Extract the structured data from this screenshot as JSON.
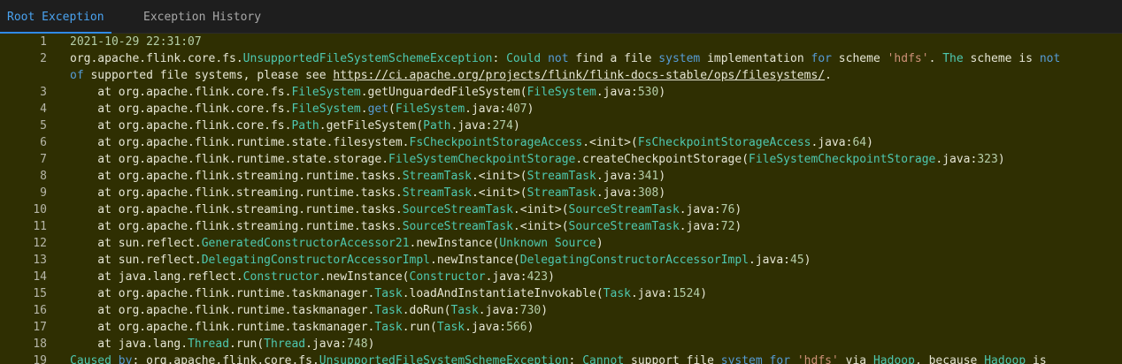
{
  "tabs": [
    {
      "label": "Root Exception",
      "active": true
    },
    {
      "label": "Exception History",
      "active": false
    }
  ],
  "colors": {
    "editor_background": "#2f2f02",
    "active_tab": "#4aa3f0",
    "class_name": "#4ec9b0",
    "number": "#b5cea8",
    "keyword": "#569cd6",
    "string": "#ce9178"
  },
  "lines": [
    {
      "n": "1",
      "segments": [
        {
          "t": "2021-10-29 22:31:07",
          "c": "num"
        }
      ]
    },
    {
      "n": "2",
      "segments": [
        {
          "t": "org.apache.flink.core.fs.",
          "c": ""
        },
        {
          "t": "UnsupportedFileSystemSchemeException",
          "c": "cls"
        },
        {
          "t": ": ",
          "c": ""
        },
        {
          "t": "Could ",
          "c": "cls"
        },
        {
          "t": "not",
          "c": "kw"
        },
        {
          "t": " find a file ",
          "c": ""
        },
        {
          "t": "system",
          "c": "kw"
        },
        {
          "t": " implementation ",
          "c": ""
        },
        {
          "t": "for",
          "c": "kw"
        },
        {
          "t": " scheme ",
          "c": ""
        },
        {
          "t": "'hdfs'",
          "c": "str"
        },
        {
          "t": ". ",
          "c": ""
        },
        {
          "t": "The",
          "c": "cls"
        },
        {
          "t": " scheme is ",
          "c": ""
        },
        {
          "t": "not",
          "c": "kw"
        }
      ]
    },
    {
      "n": "",
      "segments": [
        {
          "t": "of",
          "c": "kw"
        },
        {
          "t": " supported file systems, please see ",
          "c": ""
        },
        {
          "t": "https://ci.apache.org/projects/flink/flink-docs-stable/ops/filesystems/",
          "c": "link"
        },
        {
          "t": ".",
          "c": ""
        }
      ]
    },
    {
      "n": "3",
      "segments": [
        {
          "t": "    at org.apache.flink.core.fs.",
          "c": ""
        },
        {
          "t": "FileSystem",
          "c": "cls"
        },
        {
          "t": ".getUnguardedFileSystem(",
          "c": ""
        },
        {
          "t": "FileSystem",
          "c": "cls"
        },
        {
          "t": ".java:",
          "c": ""
        },
        {
          "t": "530",
          "c": "num"
        },
        {
          "t": ")",
          "c": ""
        }
      ]
    },
    {
      "n": "4",
      "segments": [
        {
          "t": "    at org.apache.flink.core.fs.",
          "c": ""
        },
        {
          "t": "FileSystem",
          "c": "cls"
        },
        {
          "t": ".",
          "c": ""
        },
        {
          "t": "get",
          "c": "kw"
        },
        {
          "t": "(",
          "c": ""
        },
        {
          "t": "FileSystem",
          "c": "cls"
        },
        {
          "t": ".java:",
          "c": ""
        },
        {
          "t": "407",
          "c": "num"
        },
        {
          "t": ")",
          "c": ""
        }
      ]
    },
    {
      "n": "5",
      "segments": [
        {
          "t": "    at org.apache.flink.core.fs.",
          "c": ""
        },
        {
          "t": "Path",
          "c": "cls"
        },
        {
          "t": ".getFileSystem(",
          "c": ""
        },
        {
          "t": "Path",
          "c": "cls"
        },
        {
          "t": ".java:",
          "c": ""
        },
        {
          "t": "274",
          "c": "num"
        },
        {
          "t": ")",
          "c": ""
        }
      ]
    },
    {
      "n": "6",
      "segments": [
        {
          "t": "    at org.apache.flink.runtime.state.filesystem.",
          "c": ""
        },
        {
          "t": "FsCheckpointStorageAccess",
          "c": "cls"
        },
        {
          "t": ".<init>(",
          "c": ""
        },
        {
          "t": "FsCheckpointStorageAccess",
          "c": "cls"
        },
        {
          "t": ".java:",
          "c": ""
        },
        {
          "t": "64",
          "c": "num"
        },
        {
          "t": ")",
          "c": ""
        }
      ]
    },
    {
      "n": "7",
      "segments": [
        {
          "t": "    at org.apache.flink.runtime.state.storage.",
          "c": ""
        },
        {
          "t": "FileSystemCheckpointStorage",
          "c": "cls"
        },
        {
          "t": ".createCheckpointStorage(",
          "c": ""
        },
        {
          "t": "FileSystemCheckpointStorage",
          "c": "cls"
        },
        {
          "t": ".java:",
          "c": ""
        },
        {
          "t": "323",
          "c": "num"
        },
        {
          "t": ")",
          "c": ""
        }
      ]
    },
    {
      "n": "8",
      "segments": [
        {
          "t": "    at org.apache.flink.streaming.runtime.tasks.",
          "c": ""
        },
        {
          "t": "StreamTask",
          "c": "cls"
        },
        {
          "t": ".<init>(",
          "c": ""
        },
        {
          "t": "StreamTask",
          "c": "cls"
        },
        {
          "t": ".java:",
          "c": ""
        },
        {
          "t": "341",
          "c": "num"
        },
        {
          "t": ")",
          "c": ""
        }
      ]
    },
    {
      "n": "9",
      "segments": [
        {
          "t": "    at org.apache.flink.streaming.runtime.tasks.",
          "c": ""
        },
        {
          "t": "StreamTask",
          "c": "cls"
        },
        {
          "t": ".<init>(",
          "c": ""
        },
        {
          "t": "StreamTask",
          "c": "cls"
        },
        {
          "t": ".java:",
          "c": ""
        },
        {
          "t": "308",
          "c": "num"
        },
        {
          "t": ")",
          "c": ""
        }
      ]
    },
    {
      "n": "10",
      "segments": [
        {
          "t": "    at org.apache.flink.streaming.runtime.tasks.",
          "c": ""
        },
        {
          "t": "SourceStreamTask",
          "c": "cls"
        },
        {
          "t": ".<init>(",
          "c": ""
        },
        {
          "t": "SourceStreamTask",
          "c": "cls"
        },
        {
          "t": ".java:",
          "c": ""
        },
        {
          "t": "76",
          "c": "num"
        },
        {
          "t": ")",
          "c": ""
        }
      ]
    },
    {
      "n": "11",
      "segments": [
        {
          "t": "    at org.apache.flink.streaming.runtime.tasks.",
          "c": ""
        },
        {
          "t": "SourceStreamTask",
          "c": "cls"
        },
        {
          "t": ".<init>(",
          "c": ""
        },
        {
          "t": "SourceStreamTask",
          "c": "cls"
        },
        {
          "t": ".java:",
          "c": ""
        },
        {
          "t": "72",
          "c": "num"
        },
        {
          "t": ")",
          "c": ""
        }
      ]
    },
    {
      "n": "12",
      "segments": [
        {
          "t": "    at sun.reflect.",
          "c": ""
        },
        {
          "t": "GeneratedConstructorAccessor21",
          "c": "cls"
        },
        {
          "t": ".newInstance(",
          "c": ""
        },
        {
          "t": "Unknown Source",
          "c": "cls"
        },
        {
          "t": ")",
          "c": ""
        }
      ]
    },
    {
      "n": "13",
      "segments": [
        {
          "t": "    at sun.reflect.",
          "c": ""
        },
        {
          "t": "DelegatingConstructorAccessorImpl",
          "c": "cls"
        },
        {
          "t": ".newInstance(",
          "c": ""
        },
        {
          "t": "DelegatingConstructorAccessorImpl",
          "c": "cls"
        },
        {
          "t": ".java:",
          "c": ""
        },
        {
          "t": "45",
          "c": "num"
        },
        {
          "t": ")",
          "c": ""
        }
      ]
    },
    {
      "n": "14",
      "segments": [
        {
          "t": "    at java.lang.reflect.",
          "c": ""
        },
        {
          "t": "Constructor",
          "c": "cls"
        },
        {
          "t": ".newInstance(",
          "c": ""
        },
        {
          "t": "Constructor",
          "c": "cls"
        },
        {
          "t": ".java:",
          "c": ""
        },
        {
          "t": "423",
          "c": "num"
        },
        {
          "t": ")",
          "c": ""
        }
      ]
    },
    {
      "n": "15",
      "segments": [
        {
          "t": "    at org.apache.flink.runtime.taskmanager.",
          "c": ""
        },
        {
          "t": "Task",
          "c": "cls"
        },
        {
          "t": ".loadAndInstantiateInvokable(",
          "c": ""
        },
        {
          "t": "Task",
          "c": "cls"
        },
        {
          "t": ".java:",
          "c": ""
        },
        {
          "t": "1524",
          "c": "num"
        },
        {
          "t": ")",
          "c": ""
        }
      ]
    },
    {
      "n": "16",
      "segments": [
        {
          "t": "    at org.apache.flink.runtime.taskmanager.",
          "c": ""
        },
        {
          "t": "Task",
          "c": "cls"
        },
        {
          "t": ".doRun(",
          "c": ""
        },
        {
          "t": "Task",
          "c": "cls"
        },
        {
          "t": ".java:",
          "c": ""
        },
        {
          "t": "730",
          "c": "num"
        },
        {
          "t": ")",
          "c": ""
        }
      ]
    },
    {
      "n": "17",
      "segments": [
        {
          "t": "    at org.apache.flink.runtime.taskmanager.",
          "c": ""
        },
        {
          "t": "Task",
          "c": "cls"
        },
        {
          "t": ".run(",
          "c": ""
        },
        {
          "t": "Task",
          "c": "cls"
        },
        {
          "t": ".java:",
          "c": ""
        },
        {
          "t": "566",
          "c": "num"
        },
        {
          "t": ")",
          "c": ""
        }
      ]
    },
    {
      "n": "18",
      "segments": [
        {
          "t": "    at java.lang.",
          "c": ""
        },
        {
          "t": "Thread",
          "c": "cls"
        },
        {
          "t": ".run(",
          "c": ""
        },
        {
          "t": "Thread",
          "c": "cls"
        },
        {
          "t": ".java:",
          "c": ""
        },
        {
          "t": "748",
          "c": "num"
        },
        {
          "t": ")",
          "c": ""
        }
      ]
    },
    {
      "n": "19",
      "segments": [
        {
          "t": "Caused ",
          "c": "cls"
        },
        {
          "t": "by",
          "c": "kw"
        },
        {
          "t": ": org.apache.flink.core.fs.",
          "c": ""
        },
        {
          "t": "UnsupportedFileSystemSchemeException",
          "c": "cls"
        },
        {
          "t": ": ",
          "c": ""
        },
        {
          "t": "Cannot",
          "c": "cls"
        },
        {
          "t": " support file ",
          "c": ""
        },
        {
          "t": "system",
          "c": "kw"
        },
        {
          "t": " ",
          "c": ""
        },
        {
          "t": "for",
          "c": "kw"
        },
        {
          "t": " ",
          "c": ""
        },
        {
          "t": "'hdfs'",
          "c": "str"
        },
        {
          "t": " via ",
          "c": ""
        },
        {
          "t": "Hadoop",
          "c": "cls"
        },
        {
          "t": ", because ",
          "c": ""
        },
        {
          "t": "Hadoop",
          "c": "cls"
        },
        {
          "t": " is",
          "c": ""
        }
      ]
    }
  ]
}
